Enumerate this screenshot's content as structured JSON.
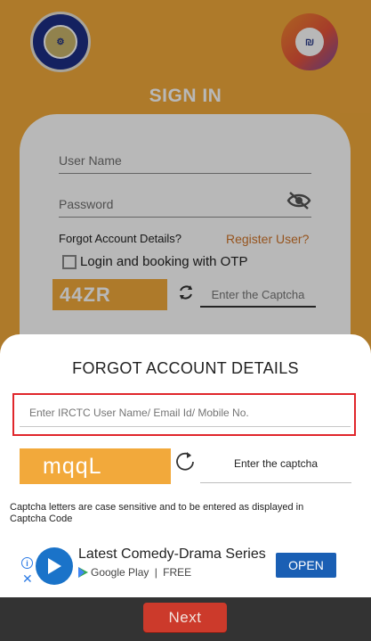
{
  "header": {
    "title": "SIGN IN",
    "left_logo": "indian-railways-logo",
    "right_logo": "irctc-logo"
  },
  "login_form": {
    "username_placeholder": "User Name",
    "password_placeholder": "Password",
    "forgot_link": "Forgot Account Details?",
    "register_link": "Register User?",
    "otp_label": "Login and booking with OTP",
    "captcha_text": "44ZR",
    "captcha_placeholder": "Enter the Captcha"
  },
  "dialog": {
    "title": "FORGOT ACCOUNT DETAILS",
    "user_field_placeholder": "Enter IRCTC User Name/ Email Id/ Mobile No.",
    "captcha_text": "mqqL",
    "captcha_placeholder": "Enter the captcha",
    "note": "Captcha letters are case sensitive and to be entered as displayed in Captcha Code"
  },
  "ad": {
    "title": "Latest Comedy-Drama Series",
    "store": "Google Play",
    "price": "FREE",
    "cta": "OPEN"
  },
  "footer": {
    "next_label": "Next"
  },
  "colors": {
    "brand_orange": "#f2a93b",
    "link_orange": "#d0752a",
    "highlight_red": "#e0262b",
    "next_red": "#cc3a2b",
    "ad_blue": "#1a5fb4"
  }
}
